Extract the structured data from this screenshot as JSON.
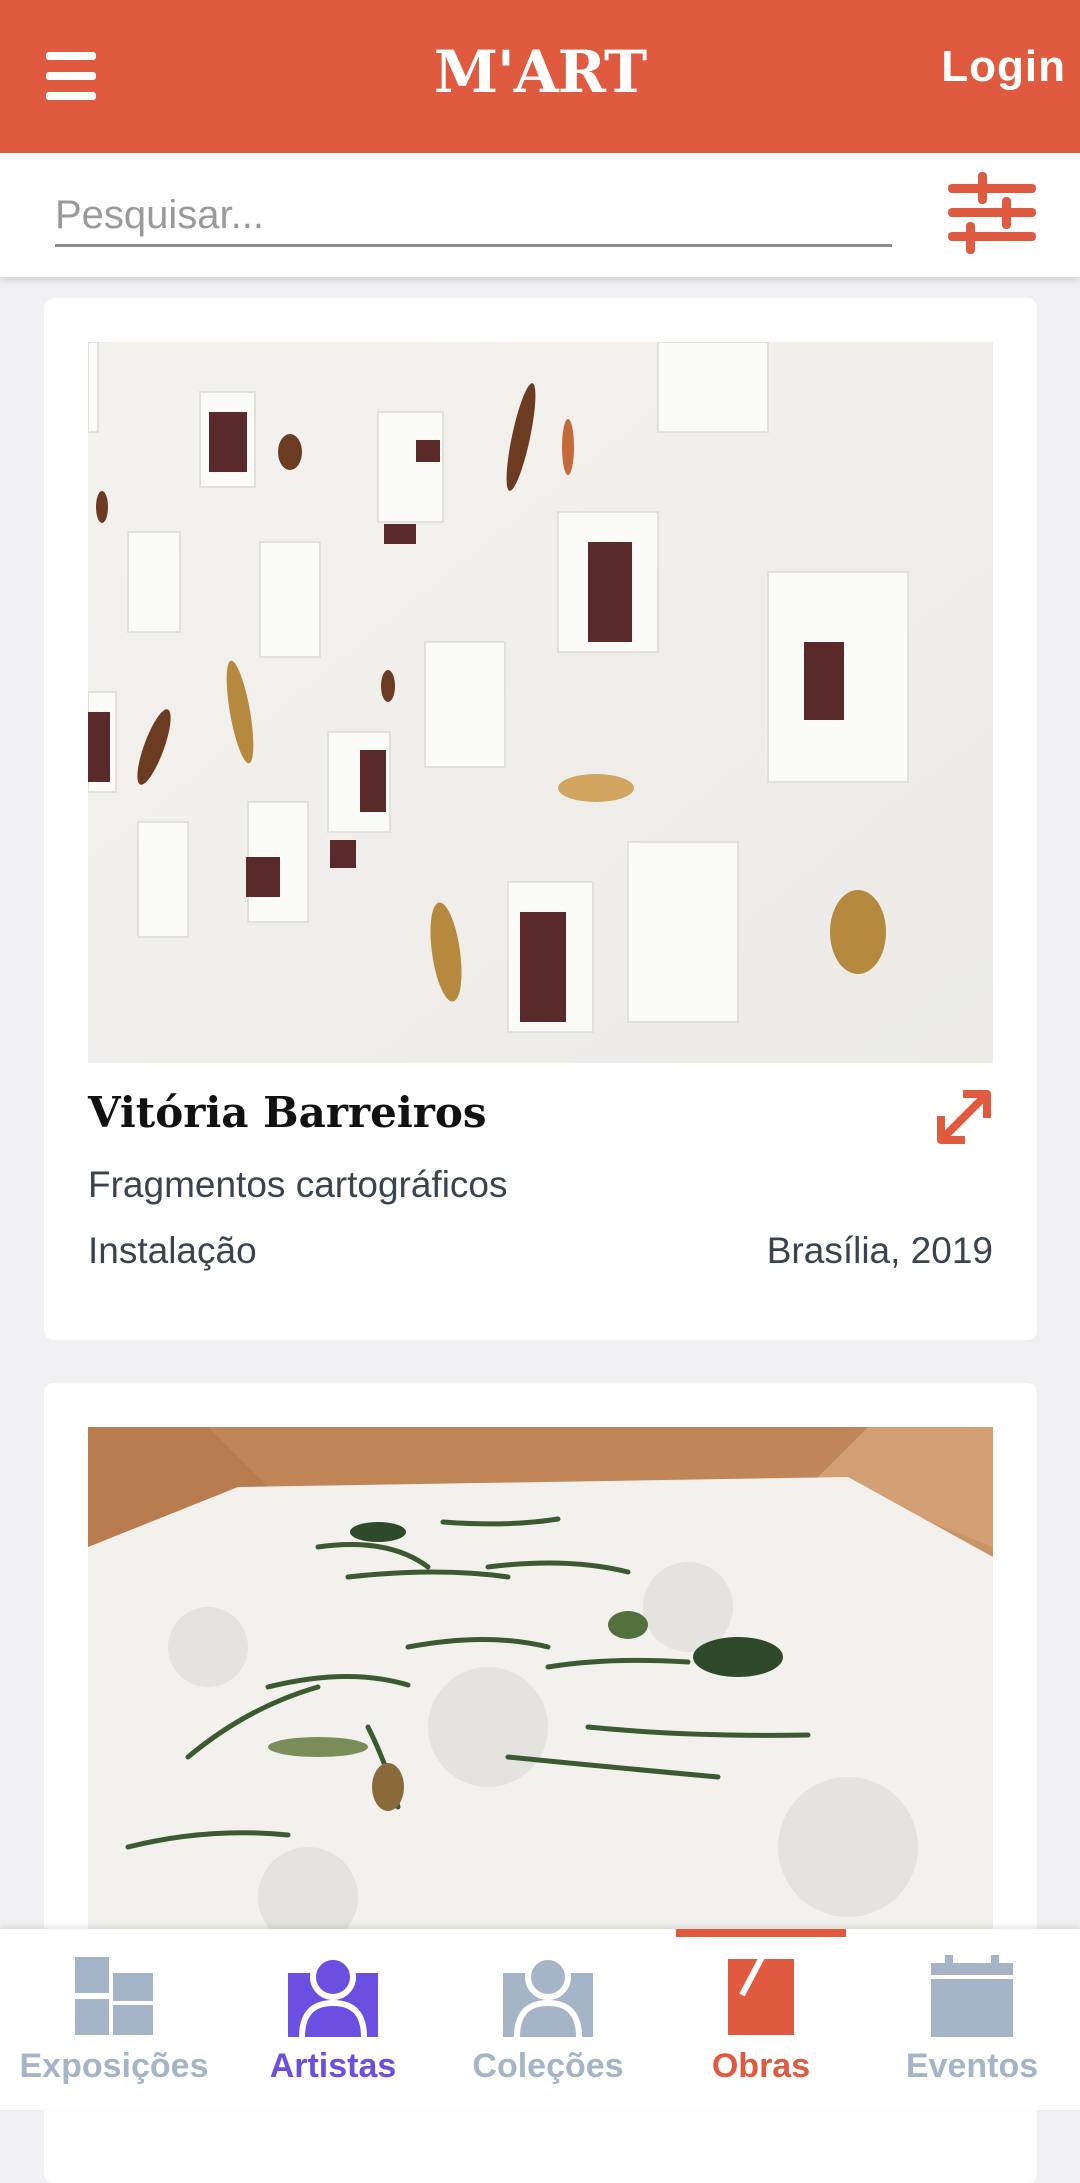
{
  "app": {
    "logo": "M'ART",
    "login_label": "Login"
  },
  "search": {
    "placeholder": "Pesquisar..."
  },
  "cards": [
    {
      "artist": "Vitória Barreiros",
      "title": "Fragmentos cartográficos",
      "type": "Instalação",
      "place": "Brasília, 2019"
    },
    {
      "artist": "",
      "title": "",
      "type": "",
      "place": ""
    }
  ],
  "nav": {
    "items": [
      {
        "label": "Exposições",
        "icon": "grid-icon"
      },
      {
        "label": "Artistas",
        "icon": "person-icon"
      },
      {
        "label": "Coleções",
        "icon": "person-icon"
      },
      {
        "label": "Obras",
        "icon": "artwork-icon"
      },
      {
        "label": "Eventos",
        "icon": "calendar-icon"
      }
    ],
    "active": "Obras"
  },
  "colors": {
    "brand": "#e05a3f",
    "artistas_accent": "#6a4fe0",
    "inactive": "#a5b4c6"
  }
}
